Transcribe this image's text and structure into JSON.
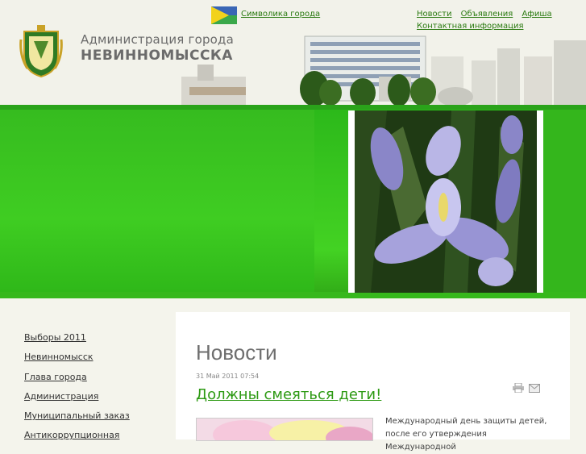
{
  "header": {
    "admin_line1": "Администрация города",
    "admin_line2": "НЕВИННОМЫССКА",
    "symbolika": "Символика города",
    "top_nav": [
      "Новости",
      "Объявления",
      "Афиша"
    ],
    "contact": "Контактная информация"
  },
  "sidebar": {
    "items": [
      "Выборы 2011",
      "Невинномысск",
      "Глава города",
      "Администрация",
      "Муниципальный заказ",
      "Антикоррупционная"
    ]
  },
  "main": {
    "title": "Новости",
    "date": "31 Май 2011 07:54",
    "article_title": "Должны смеяться дети!",
    "article_text_1": "Международный день защиты детей,",
    "article_text_2": "после его утверждения Международной"
  },
  "colors": {
    "brand_green": "#2e9a14",
    "banner_green": "#3fcd22",
    "link_green": "#2a7a10"
  }
}
